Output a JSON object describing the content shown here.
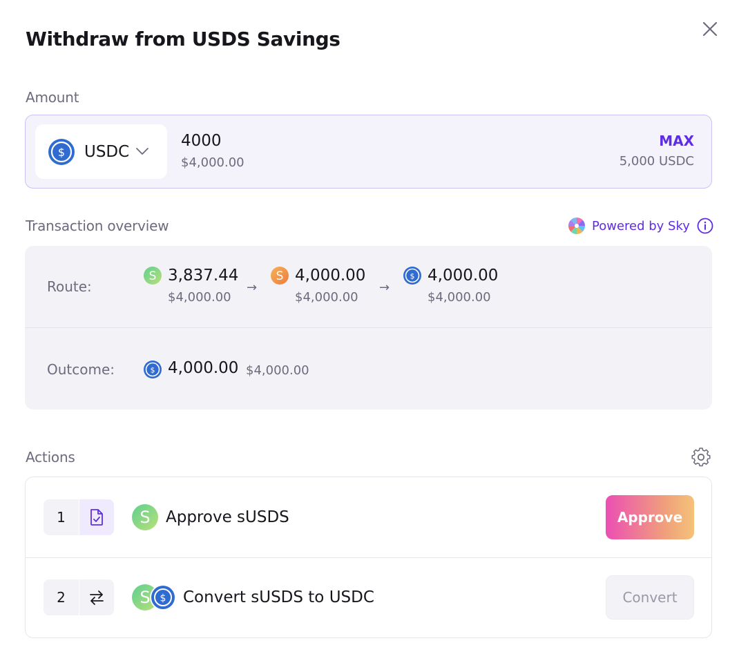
{
  "modal": {
    "title": "Withdraw from USDS Savings"
  },
  "amount": {
    "label": "Amount",
    "token": "USDC",
    "value": "4000",
    "value_usd": "$4,000.00",
    "max_label": "MAX",
    "balance": "5,000 USDC"
  },
  "overview": {
    "label": "Transaction overview",
    "powered_by": "Powered by Sky",
    "route_label": "Route:",
    "route": [
      {
        "token": "sUSDS",
        "amount": "3,837.44",
        "usd": "$4,000.00"
      },
      {
        "token": "USDS",
        "amount": "4,000.00",
        "usd": "$4,000.00"
      },
      {
        "token": "USDC",
        "amount": "4,000.00",
        "usd": "$4,000.00"
      }
    ],
    "arrow": "→",
    "outcome_label": "Outcome:",
    "outcome_amount": "4,000.00",
    "outcome_usd": "$4,000.00"
  },
  "actions": {
    "label": "Actions",
    "steps": [
      {
        "number": "1",
        "title": "Approve sUSDS",
        "button": "Approve",
        "icon": "approve-document-icon"
      },
      {
        "number": "2",
        "title": "Convert sUSDS to USDC",
        "button": "Convert",
        "icon": "swap-arrows-icon"
      }
    ]
  },
  "colors": {
    "accent": "#5f2ce6",
    "usdc": "#2f6bd1",
    "susds": "#6fcf8f",
    "usds": "#f29a4a"
  }
}
